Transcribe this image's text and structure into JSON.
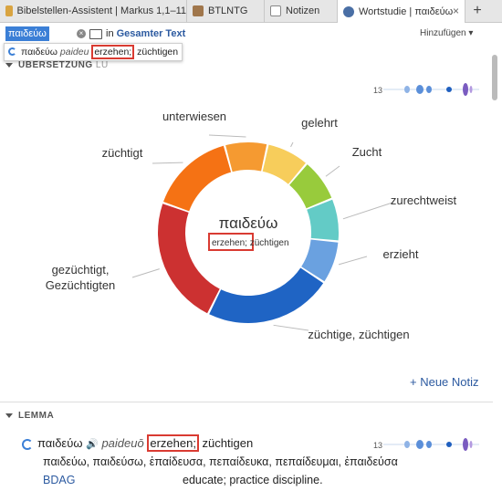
{
  "tabs": [
    {
      "label": "Bibelstellen-Assistent | Markus 1,1–11",
      "icon": "book-icon",
      "color": "#d9a441"
    },
    {
      "label": "BTLNTG",
      "icon": "book-icon",
      "color": "#a0764b"
    },
    {
      "label": "Notizen",
      "icon": "notes-icon",
      "color": "#777777"
    },
    {
      "label": "Wortstudie | παιδεύω",
      "icon": "word-study-icon",
      "color": "#4a6fa5",
      "close": "×"
    }
  ],
  "add_tab": "+",
  "toolbar": {
    "search_value": "παιδεύω",
    "in_label": "in",
    "scope": "Gesamter Text",
    "add_label": "Hinzufügen ▾"
  },
  "suggestion": {
    "lemma": "παιδεύω",
    "translit": "paideu",
    "gloss_hl": "erzehen;",
    "gloss_rest": " züchtigen"
  },
  "section_translation": {
    "title": "ÜBERSETZUNG",
    "suffix": "LU",
    "count": "13"
  },
  "chart_data": {
    "type": "pie",
    "center_label": "παιδεύω",
    "center_sub_hl": "erzehen;",
    "center_sub_rest": " züchtigen",
    "slices": [
      {
        "label": "unterwiesen",
        "value": 1,
        "color": "#f59a31"
      },
      {
        "label": "gelehrt",
        "value": 1,
        "color": "#f7cd5b"
      },
      {
        "label": "Zucht",
        "value": 1,
        "color": "#98cb3c"
      },
      {
        "label": "zurechtweist",
        "value": 1,
        "color": "#63cbc6"
      },
      {
        "label": "erzieht",
        "value": 1,
        "color": "#6aa1e0"
      },
      {
        "label": "züchtige, züchtigen",
        "value": 3,
        "color": "#1f64c4"
      },
      {
        "label": "gezüchtigt, Gezüchtigten",
        "value": 3,
        "color": "#cc3131"
      },
      {
        "label": "züchtigt",
        "value": 2,
        "color": "#f57214"
      }
    ]
  },
  "new_note": "+ Neue Notiz",
  "section_lemma": {
    "title": "LEMMA",
    "count": "13"
  },
  "lemma": {
    "word": "παιδεύω",
    "translit": "paideuō",
    "gloss_hl": "erzehen;",
    "gloss_rest": " züchtigen",
    "forms": "παιδεύω, παιδεύσω, ἐπαίδευσα, πεπαίδευκα, πεπαίδευμαι, ἐπαιδεύσα",
    "source": "BDAG",
    "definition": "educate; practice discipline."
  }
}
